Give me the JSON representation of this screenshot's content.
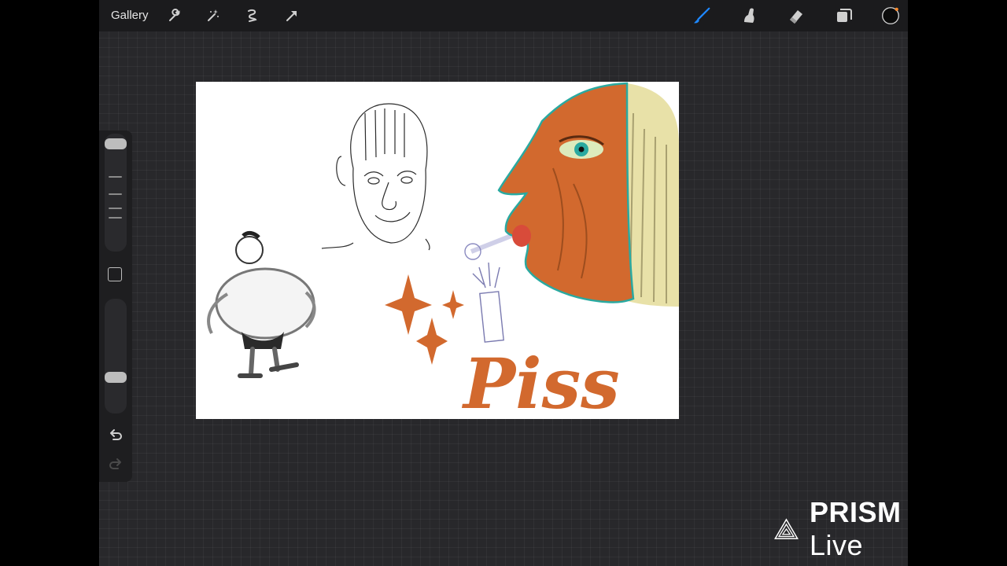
{
  "topbar": {
    "gallery_label": "Gallery",
    "left_tools": [
      "wrench-icon",
      "magic-wand-icon",
      "selection-icon",
      "transform-arrow-icon"
    ],
    "right_tools": [
      "brush-icon",
      "smudge-icon",
      "eraser-icon",
      "layers-icon",
      "color-swatch-icon"
    ],
    "active_tool": "brush-icon",
    "brush_accent_color": "#1e88ff",
    "color_swatch_color": "#0b0b0b",
    "color_dot": "#ff8a2a"
  },
  "sidebar": {
    "brush_size_slider": "size",
    "opacity_slider": "opacity",
    "undo_icon": "undo-icon",
    "redo_icon": "redo-icon"
  },
  "canvas": {
    "artwork_text": "Piss",
    "colors": {
      "orange": "#d2692e",
      "hair": "#e8e1a8",
      "teal": "#2aa9a0"
    }
  },
  "watermark": {
    "brand": "PRISM",
    "suffix": "Live"
  }
}
